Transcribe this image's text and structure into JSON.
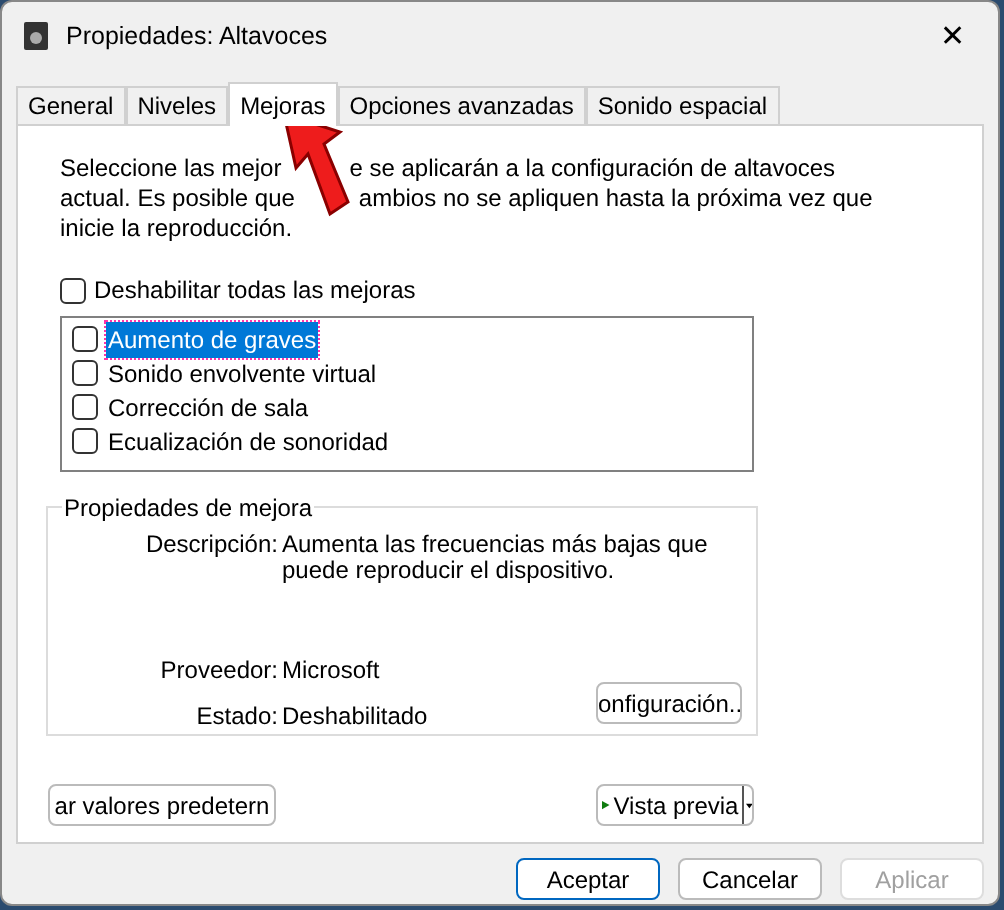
{
  "window": {
    "title": "Propiedades: Altavoces",
    "close": "✕"
  },
  "tabs": [
    {
      "label": "General",
      "selected": false
    },
    {
      "label": "Niveles",
      "selected": false
    },
    {
      "label": "Mejoras",
      "selected": true
    },
    {
      "label": "Opciones avanzadas",
      "selected": false
    },
    {
      "label": "Sonido espacial",
      "selected": false
    }
  ],
  "intro_lines": [
    [
      "Seleccione las mejor",
      "e se aplicarán a la configuración de altavoces"
    ],
    [
      "actual. Es posible que",
      "ambios no se apliquen hasta la próxima vez que"
    ],
    [
      "inicie la reproducción."
    ]
  ],
  "disable_all": {
    "label": "Deshabilitar todas las mejoras",
    "checked": false
  },
  "enhancements": [
    {
      "label": "Aumento de graves",
      "checked": false,
      "selected": true
    },
    {
      "label": "Sonido envolvente virtual",
      "checked": false,
      "selected": false
    },
    {
      "label": "Corrección de sala",
      "checked": false,
      "selected": false
    },
    {
      "label": "Ecualización de sonoridad",
      "checked": false,
      "selected": false
    }
  ],
  "properties": {
    "title": "Propiedades de mejora",
    "fields": [
      {
        "label": "Descripción:",
        "value": "Aumenta las frecuencias más bajas que puede reproducir el dispositivo."
      },
      {
        "label": "Proveedor:",
        "value": "Microsoft"
      },
      {
        "label": "Estado:",
        "value": "Deshabilitado"
      }
    ],
    "settings_button": "onfiguración.."
  },
  "restore_button": "ar valores predetern",
  "preview_button": "Vista previa",
  "buttons": [
    {
      "label": "Aceptar",
      "kind": "default",
      "disabled": false
    },
    {
      "label": "Cancelar",
      "kind": "normal",
      "disabled": false
    },
    {
      "label": "Aplicar",
      "kind": "normal",
      "disabled": true
    }
  ]
}
